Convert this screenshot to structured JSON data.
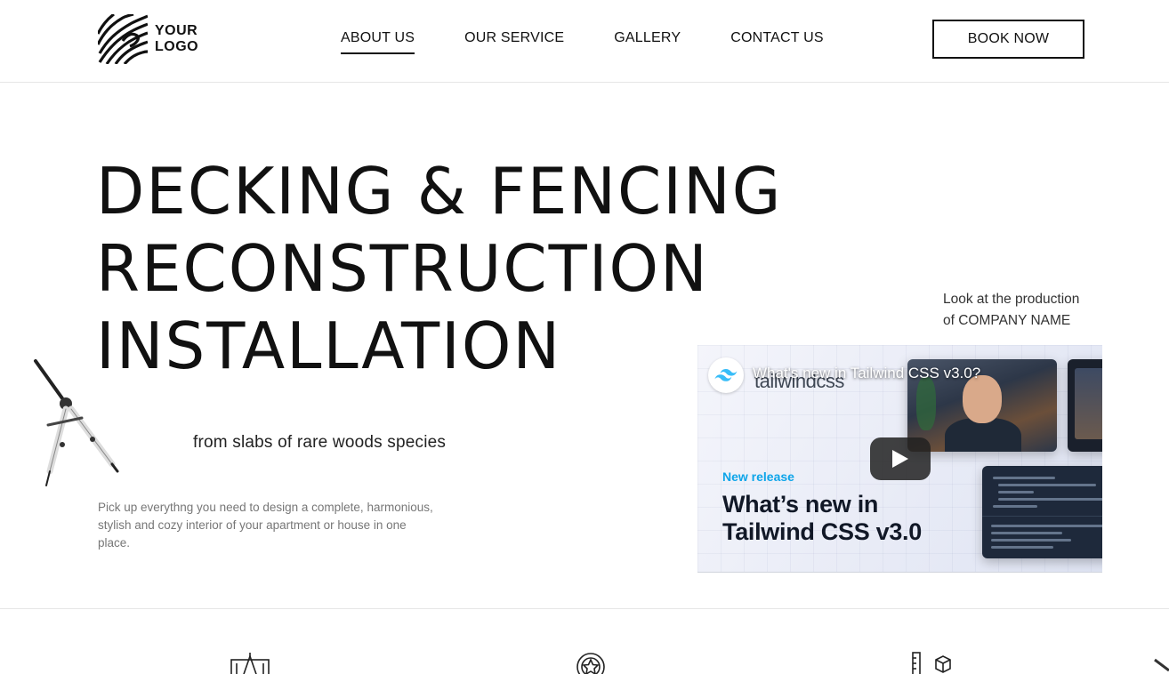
{
  "header": {
    "logo_line1": "YOUR",
    "logo_line2": "LOGO",
    "nav": [
      {
        "label": "ABOUT US",
        "active": true
      },
      {
        "label": "OUR SERVICE",
        "active": false
      },
      {
        "label": "GALLERY",
        "active": false
      },
      {
        "label": "CONTACT US",
        "active": false
      }
    ],
    "book_label": "BOOK NOW"
  },
  "hero": {
    "title_lines": [
      "DECKING & FENCING",
      "RECONSTRUCTION",
      "INSTALLATION"
    ],
    "subtitle": "from slabs of rare woods species",
    "description": "Pick up everythng you need to design a complete, harmonious, stylish and cozy interior of your apartment or house in one place."
  },
  "video_section": {
    "caption_line1": "Look at the production",
    "caption_line2": "of COMPANY NAME",
    "video_title": "What's new in Tailwind CSS v3.0?",
    "brand_word": "tailwindcss",
    "badge": "New release",
    "big_title_line1": "What’s new in",
    "big_title_line2": "Tailwind CSS v3.0"
  },
  "colors": {
    "text": "#111111",
    "muted": "#777777",
    "border": "#e6e6e6",
    "tailwind_blue": "#0ea5e9"
  },
  "icons": {
    "logo": "fingerprint-logo-icon",
    "decor": "drafting-compass-icon",
    "features": [
      "blueprint-icon",
      "star-badge-icon",
      "ruler-cube-icon"
    ]
  }
}
